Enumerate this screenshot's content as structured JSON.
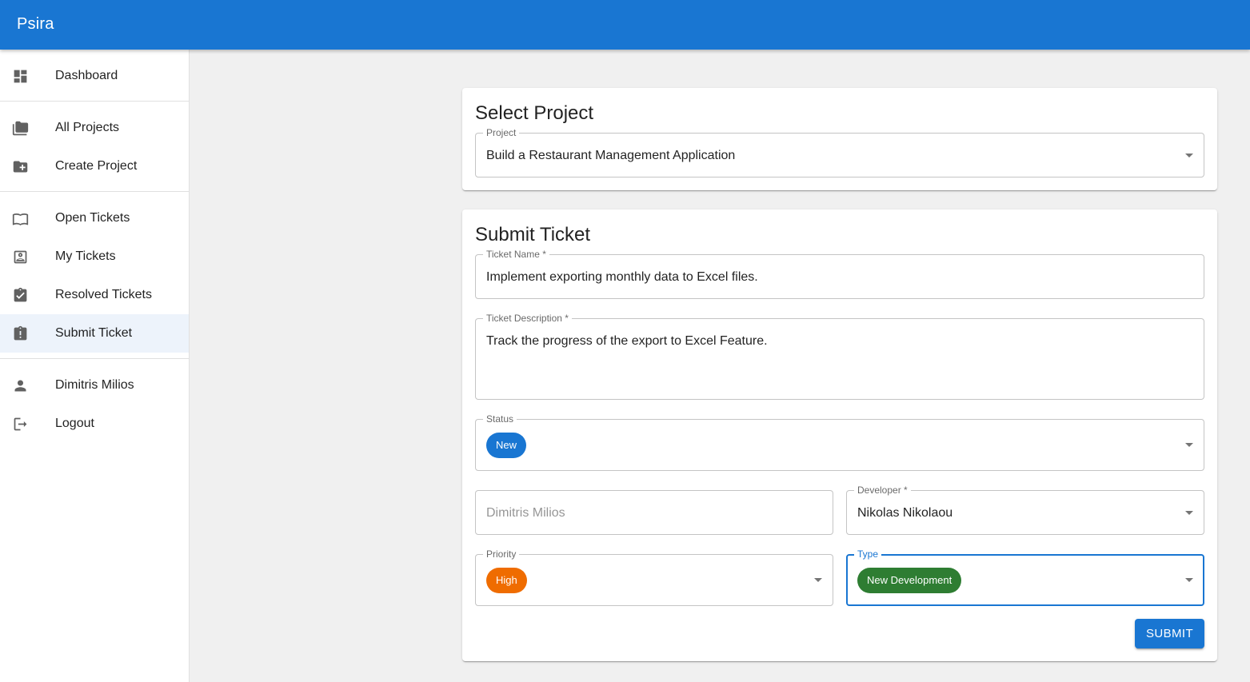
{
  "app": {
    "title": "Psira"
  },
  "colors": {
    "primary": "#1976d2",
    "status_new": "#1976d2",
    "priority_high": "#ef6c00",
    "type_new_dev": "#2e7d32"
  },
  "sidebar": {
    "items": [
      {
        "label": "Dashboard",
        "icon": "dashboard-icon"
      },
      {
        "label": "All Projects",
        "icon": "folder-icon"
      },
      {
        "label": "Create Project",
        "icon": "create-folder-icon"
      },
      {
        "label": "Open Tickets",
        "icon": "open-book-icon"
      },
      {
        "label": "My Tickets",
        "icon": "account-box-icon"
      },
      {
        "label": "Resolved Tickets",
        "icon": "assignment-turned-in-icon"
      },
      {
        "label": "Submit Ticket",
        "icon": "assignment-late-icon",
        "active": true
      },
      {
        "label": "Dimitris Milios",
        "icon": "person-icon"
      },
      {
        "label": "Logout",
        "icon": "logout-icon"
      }
    ]
  },
  "select_project": {
    "title": "Select Project",
    "project_label": "Project",
    "project_value": "Build a Restaurant Management Application"
  },
  "submit_ticket": {
    "title": "Submit Ticket",
    "ticket_name_label": "Ticket Name *",
    "ticket_name_value": "Implement exporting monthly data to Excel files.",
    "description_label": "Ticket Description *",
    "description_value": "Track the progress of the export to Excel Feature.",
    "status_label": "Status",
    "status_value": "New",
    "submitter_placeholder": "Dimitris Milios",
    "developer_label": "Developer *",
    "developer_value": "Nikolas Nikolaou",
    "priority_label": "Priority",
    "priority_value": "High",
    "type_label": "Type",
    "type_value": "New Development",
    "submit_label": "SUBMIT"
  }
}
